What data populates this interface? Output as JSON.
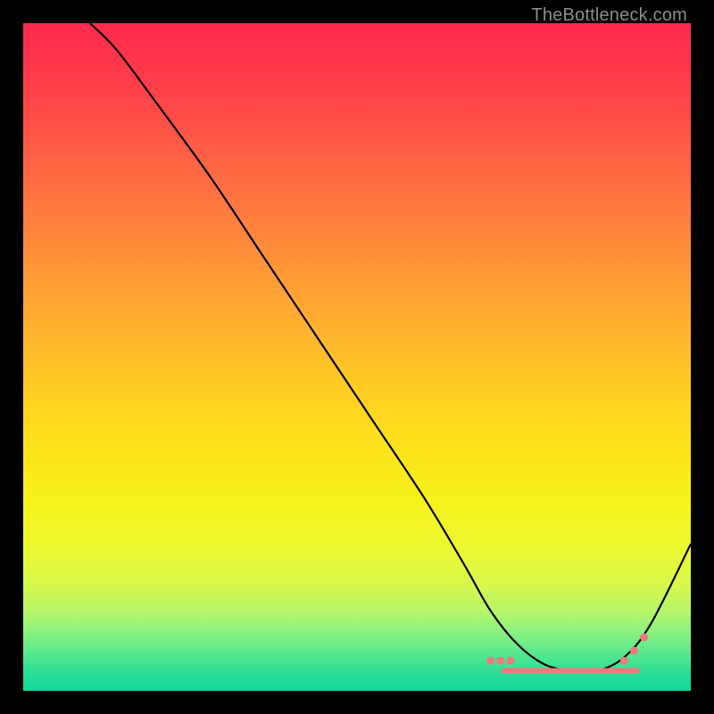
{
  "watermark": "TheBottleneck.com",
  "chart_data": {
    "type": "line",
    "title": "",
    "xlabel": "",
    "ylabel": "",
    "xlim": [
      0,
      100
    ],
    "ylim": [
      0,
      100
    ],
    "series": [
      {
        "name": "bottleneck-curve",
        "x": [
          10,
          14,
          20,
          28,
          36,
          44,
          52,
          60,
          66,
          70,
          74,
          78,
          82,
          86,
          90,
          94,
          100
        ],
        "y": [
          100,
          96,
          88,
          77,
          65,
          53,
          41,
          29,
          19,
          12,
          7,
          4,
          3,
          3,
          5,
          10,
          22
        ]
      }
    ],
    "flat_region": {
      "x_start": 72,
      "x_end": 92,
      "y": 3
    },
    "markers": {
      "left": {
        "xs": [
          70,
          71.5,
          73
        ],
        "y": 4.5
      },
      "right": {
        "xs": [
          90,
          91.5,
          93
        ],
        "ys": [
          4.5,
          6,
          8
        ]
      }
    },
    "colors": {
      "curve": "#000000",
      "markers": "#ef7a7d",
      "background_top": "#ff2a4e",
      "background_bottom": "#10d89c"
    }
  }
}
